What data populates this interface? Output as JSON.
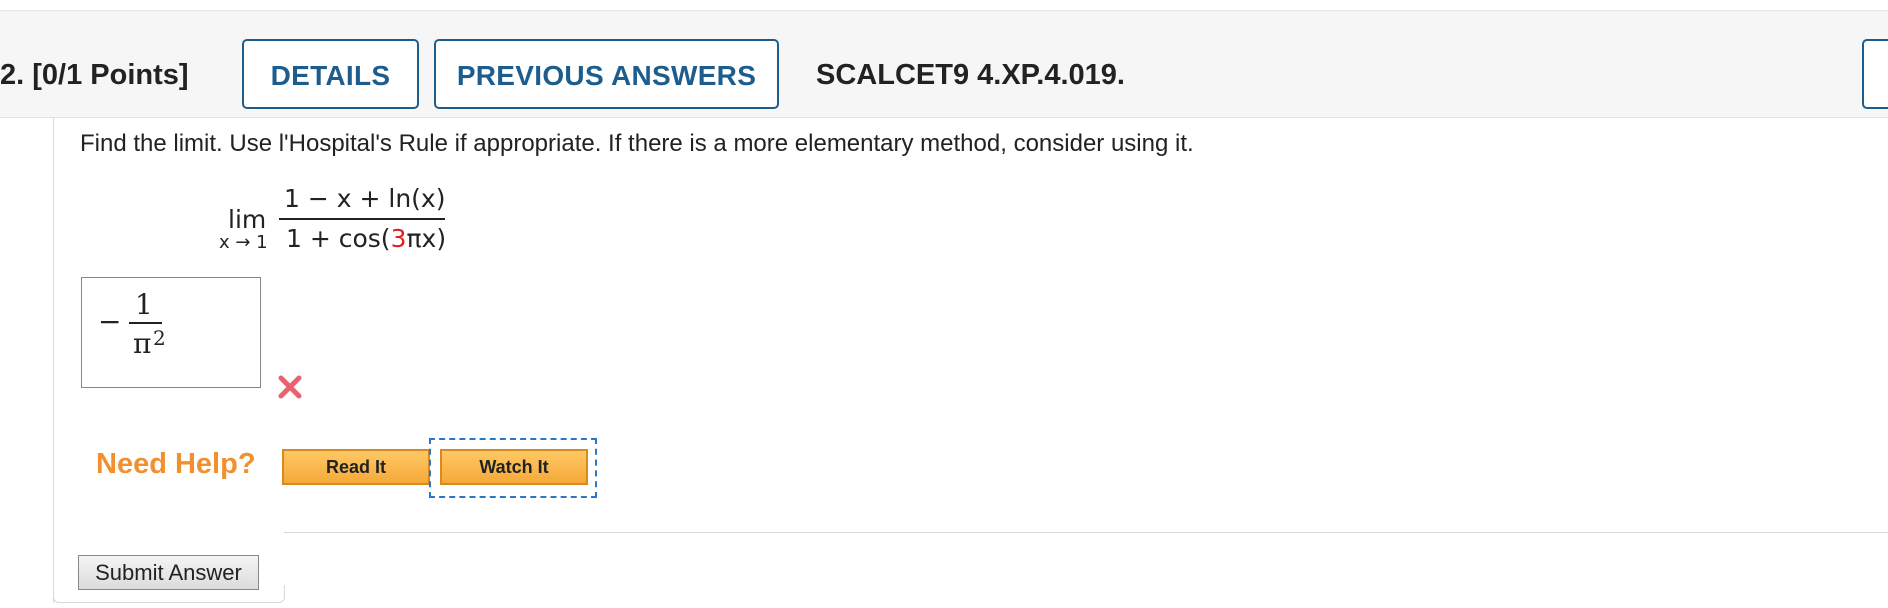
{
  "header": {
    "question_label": "2.  [0/1 Points]",
    "details_label": "DETAILS",
    "previous_answers_label": "PREVIOUS ANSWERS",
    "reference": "SCALCET9 4.XP.4.019."
  },
  "question": {
    "instruction": "Find the limit. Use l'Hospital's Rule if appropriate. If there is a more elementary method, consider using it.",
    "limit_word": "lim",
    "limit_subscript": "x → 1",
    "numerator": "1 − x + ln(x)",
    "denominator_prefix": "1 + cos(",
    "denominator_highlight": "3",
    "denominator_suffix": "πx)"
  },
  "answer": {
    "sign": "−",
    "numerator": "1",
    "denominator_base": "π",
    "denominator_exponent": "2",
    "status": "incorrect"
  },
  "help": {
    "need_help_label": "Need Help?",
    "read_it_label": "Read It",
    "watch_it_label": "Watch It"
  },
  "submit_label": "Submit Answer",
  "colors": {
    "accent_blue": "#1d5d8e",
    "highlight_red": "#e02020",
    "help_orange": "#f2902e",
    "error_x": "#e8636f"
  }
}
